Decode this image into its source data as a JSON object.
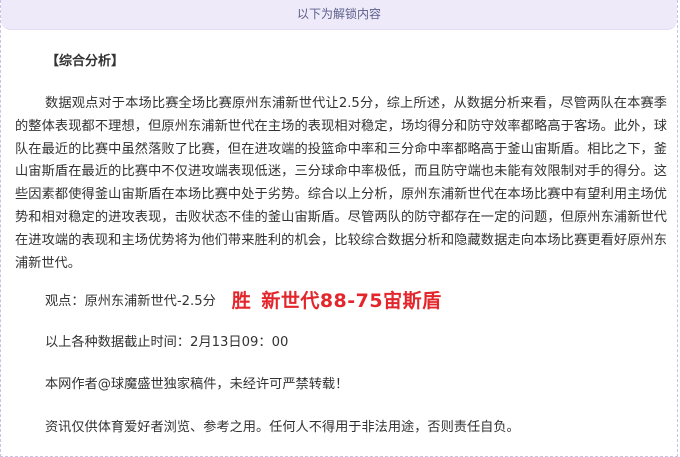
{
  "banner": {
    "label": "以下为解锁内容"
  },
  "section": {
    "title": "【综合分析】"
  },
  "analysis": {
    "body": "数据观点对于本场比赛全场比赛原州东浦新世代让2.5分，综上所述，从数据分析来看，尽管两队在本赛季的整体表现都不理想，但原州东浦新世代在主场的表现相对稳定，场均得分和防守效率都略高于客场。此外，球队在最近的比赛中虽然落败了比赛，但在进攻端的投篮命中率和三分命中率都略高于釜山宙斯盾。相比之下，釜山宙斯盾在最近的比赛中不仅进攻端表现低迷，三分球命中率极低，而且防守端也未能有效限制对手的得分。这些因素都使得釜山宙斯盾在本场比赛中处于劣势。综合以上分析，原州东浦新世代在本场比赛中有望利用主场优势和相对稳定的进攻表现，击败状态不佳的釜山宙斯盾。尽管两队的防守都存在一定的问题，但原州东浦新世代在进攻端的表现和主场优势将为他们带来胜利的机会，比较综合数据分析和隐藏数据走向本场比赛更看好原州东浦新世代。"
  },
  "viewpoint": {
    "label": "观点：",
    "text": "原州东浦新世代-2.5分",
    "result": "胜",
    "score": "新世代88-75宙斯盾",
    "result_color": "#e3262c"
  },
  "footer": {
    "cutoff": "以上各种数据截止时间：2月13日09：00",
    "copyright": "本网作者@球魔盛世独家稿件，未经许可严禁转载！",
    "disclaimer": "资讯仅供体育爱好者浏览、参考之用。任何人不得用于非法用途，否则责任自负。"
  }
}
